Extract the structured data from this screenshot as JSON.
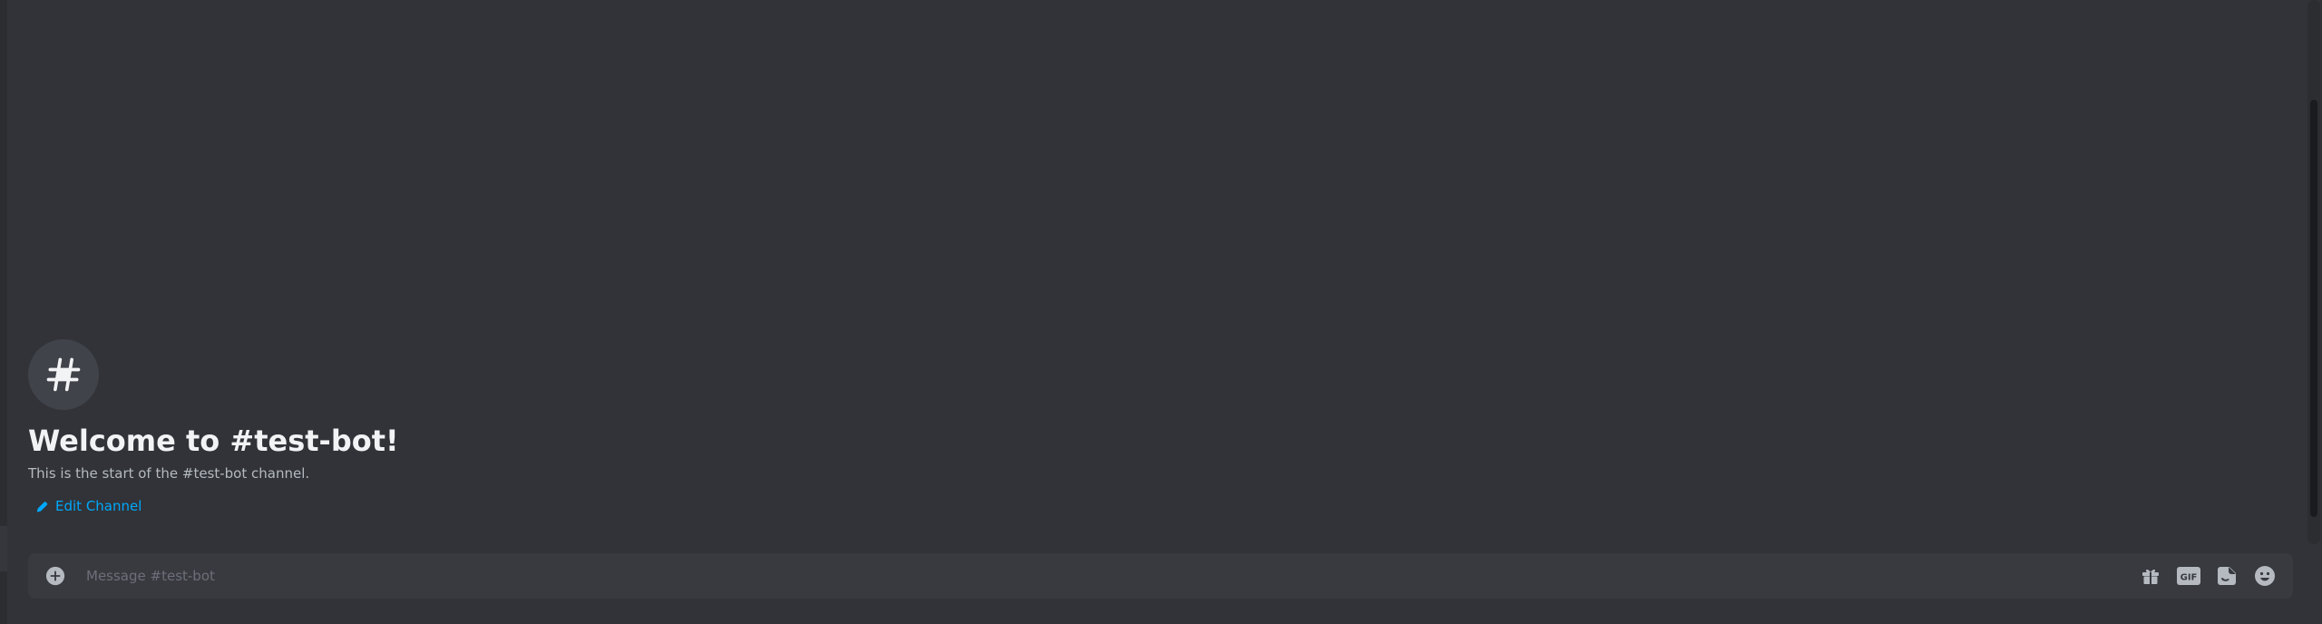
{
  "channel": {
    "name": "test-bot",
    "welcome_title": "Welcome to #test-bot!",
    "welcome_subtitle": "This is the start of the #test-bot channel.",
    "edit_label": "Edit Channel",
    "icon": "hash-icon"
  },
  "composer": {
    "placeholder": "Message #test-bot",
    "value": "",
    "left_icon": "plus-circle-icon",
    "right_icons": [
      "gift-icon",
      "gif-icon",
      "sticker-icon",
      "emoji-icon"
    ],
    "gif_label": "GIF"
  },
  "colors": {
    "background": "#313338",
    "composer_bg": "#383a40",
    "title": "#f2f3f5",
    "subtitle": "#b5bac1",
    "link": "#00a8fc",
    "icon": "#b5bac1"
  }
}
